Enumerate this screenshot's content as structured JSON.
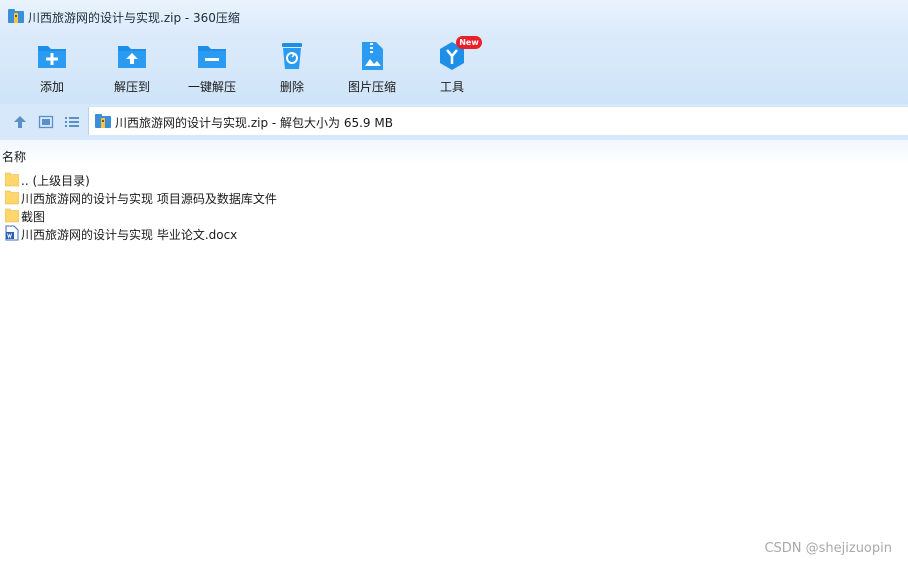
{
  "window": {
    "title": "川西旅游网的设计与实现.zip - 360压缩"
  },
  "toolbar": {
    "items": [
      {
        "label": "添加",
        "icon": "add-icon"
      },
      {
        "label": "解压到",
        "icon": "extract-to-icon"
      },
      {
        "label": "一键解压",
        "icon": "one-click-extract-icon"
      },
      {
        "label": "删除",
        "icon": "delete-icon"
      },
      {
        "label": "图片压缩",
        "icon": "image-compress-icon"
      },
      {
        "label": "工具",
        "icon": "tools-icon",
        "badge": "New"
      }
    ]
  },
  "address": {
    "text": "川西旅游网的设计与实现.zip - 解包大小为 65.9 MB"
  },
  "list": {
    "column_name": "名称",
    "items": [
      {
        "name": ".. (上级目录)",
        "type": "folder"
      },
      {
        "name": "川西旅游网的设计与实现 项目源码及数据库文件",
        "type": "folder"
      },
      {
        "name": "截图",
        "type": "folder"
      },
      {
        "name": "川西旅游网的设计与实现 毕业论文.docx",
        "type": "docx"
      }
    ]
  },
  "watermark": "CSDN @shejizuopin",
  "colors": {
    "accent": "#1e8fe8",
    "folder": "#ffd66b",
    "badge": "#e8202a"
  }
}
